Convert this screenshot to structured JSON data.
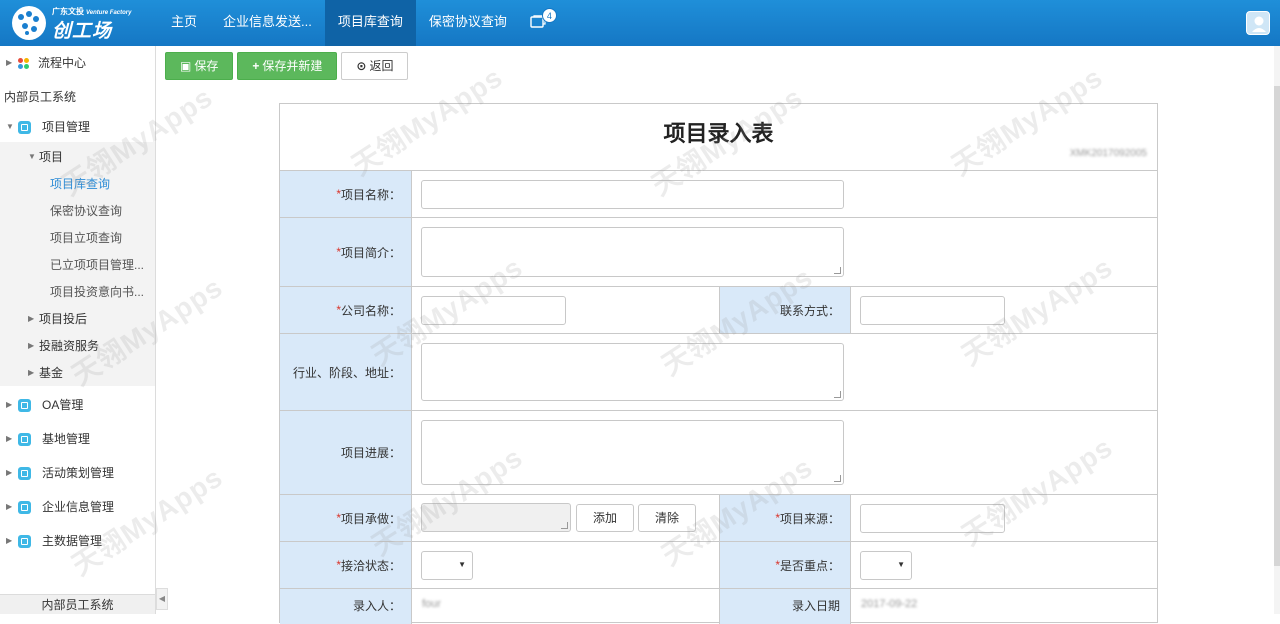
{
  "logo": {
    "small_text": "广东文投",
    "small_en": "Venture Factory",
    "big_text": "创工场"
  },
  "nav": {
    "items": [
      {
        "label": "主页"
      },
      {
        "label": "企业信息发送..."
      },
      {
        "label": "项目库查询",
        "active": true
      },
      {
        "label": "保密协议查询"
      }
    ],
    "message_badge": "4"
  },
  "sidebar": {
    "flow_center": "流程中心",
    "group_title": "内部员工系统",
    "project_mgmt": "项目管理",
    "project": "项目",
    "leaves": [
      "项目库查询",
      "保密协议查询",
      "项目立项查询",
      "已立项项目管理...",
      "项目投资意向书..."
    ],
    "sub_items": [
      "项目投后",
      "投融资服务",
      "基金"
    ],
    "modules": [
      "OA管理",
      "基地管理",
      "活动策划管理",
      "企业信息管理",
      "主数据管理"
    ],
    "footer": "内部员工系统"
  },
  "toolbar": {
    "save": "保存",
    "save_new": "保存并新建",
    "back": "返回"
  },
  "form": {
    "title": "项目录入表",
    "code": "XMK2017092005",
    "labels": {
      "project_name": "项目名称：",
      "project_intro": "项目简介：",
      "company_name": "公司名称：",
      "contact": "联系方式：",
      "industry": "行业、阶段、地址：",
      "progress": "项目进展：",
      "undertaker": "项目承做：",
      "source": "项目来源：",
      "status": "接洽状态：",
      "key": "是否重点：",
      "entered_by": "录入人：",
      "entry_date": "录入日期"
    },
    "required_mark": "*",
    "add_button": "添加",
    "clear_button": "清除",
    "entered_by_value": "four",
    "entry_date_value": "2017-09-22"
  },
  "watermark": "天翎MyApps",
  "colors": {
    "topbar": "#1a82d0",
    "accent": "#2d8cd6",
    "label_bg": "#d9e9f9",
    "green": "#5cb85c"
  }
}
